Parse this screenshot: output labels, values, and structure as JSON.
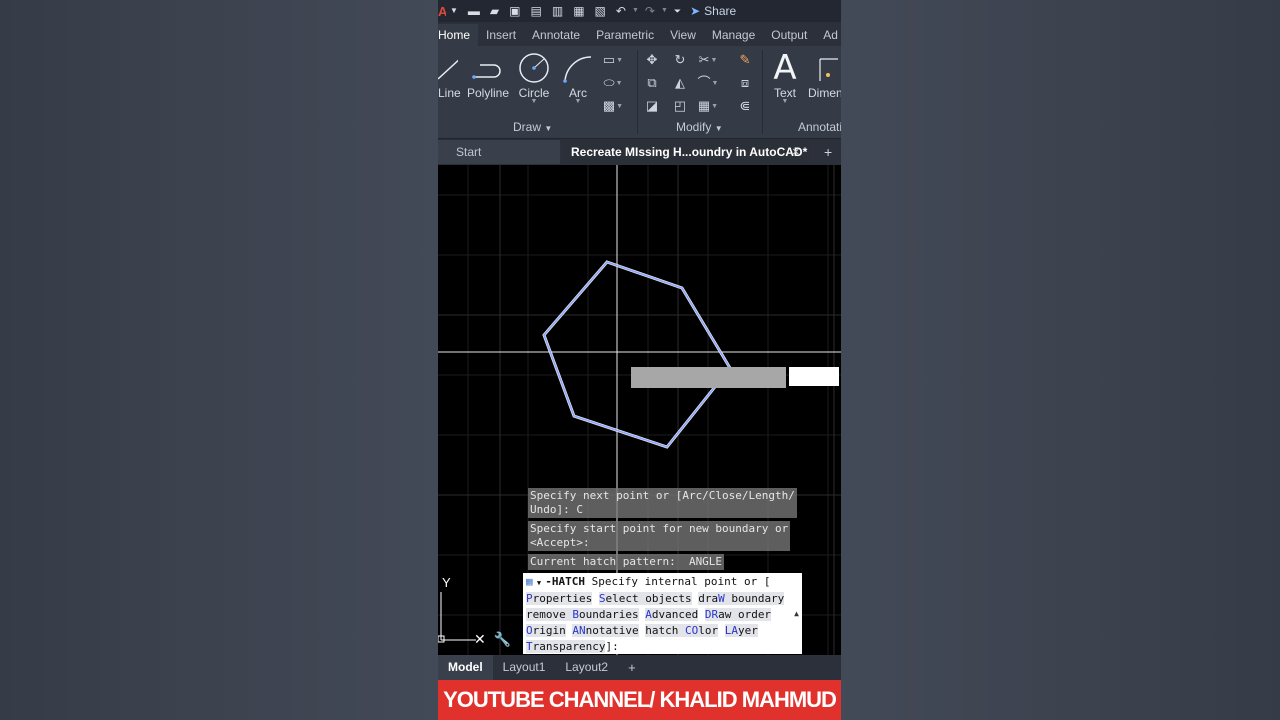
{
  "quick_access": {
    "logo_letter": "A",
    "share_label": "Share"
  },
  "ribbon": {
    "tabs": [
      "Home",
      "Insert",
      "Annotate",
      "Parametric",
      "View",
      "Manage",
      "Output",
      "Ad"
    ],
    "draw_tools": [
      {
        "label": "Line",
        "icon": "line-icon"
      },
      {
        "label": "Polyline",
        "icon": "polyline-icon"
      },
      {
        "label": "Circle",
        "icon": "circle-icon"
      },
      {
        "label": "Arc",
        "icon": "arc-icon"
      }
    ],
    "text_tool": "Text",
    "dimension_tool": "Dimen",
    "panels": {
      "draw": "Draw",
      "modify": "Modify",
      "annotation": "Annotati"
    }
  },
  "doc_tabs": {
    "start": "Start",
    "active": "Recreate MIssing H...oundry in AutoCAD*",
    "close": "×",
    "plus": "+"
  },
  "command": {
    "history": [
      "Specify next point or [Arc/Close/Length/\nUndo]: C",
      "Specify start point for new boundary or\n<Accept>:",
      "Current hatch pattern:  ANGLE"
    ],
    "command_name": "-HATCH",
    "prompt": "Specify internal point or [",
    "options": [
      {
        "key": "P",
        "rest": "roperties"
      },
      {
        "key": "S",
        "rest": "elect objects"
      },
      {
        "pre": "dra",
        "key": "W",
        "rest": " boundary"
      },
      {
        "pre": "remove ",
        "key": "B",
        "rest": "oundaries"
      },
      {
        "key": "A",
        "rest": "dvanced"
      },
      {
        "key": "DR",
        "rest": "aw order"
      },
      {
        "key": "O",
        "rest": "rigin"
      },
      {
        "key": "AN",
        "rest": "notative"
      },
      {
        "pre": "hatch ",
        "key": "CO",
        "rest": "lor"
      },
      {
        "key": "LA",
        "rest": "yer"
      },
      {
        "key": "T",
        "rest": "ransparency"
      }
    ],
    "tail": "]:",
    "ucs_label": "Y"
  },
  "layout_tabs": [
    "Model",
    "Layout1",
    "Layout2",
    "+"
  ],
  "banner": "YOUTUBE CHANNEL/ KHALID MAHMUD",
  "colors": {
    "polygon": "#8aa4ff",
    "banner": "#e0312c",
    "option_key": "#2a35c9"
  }
}
